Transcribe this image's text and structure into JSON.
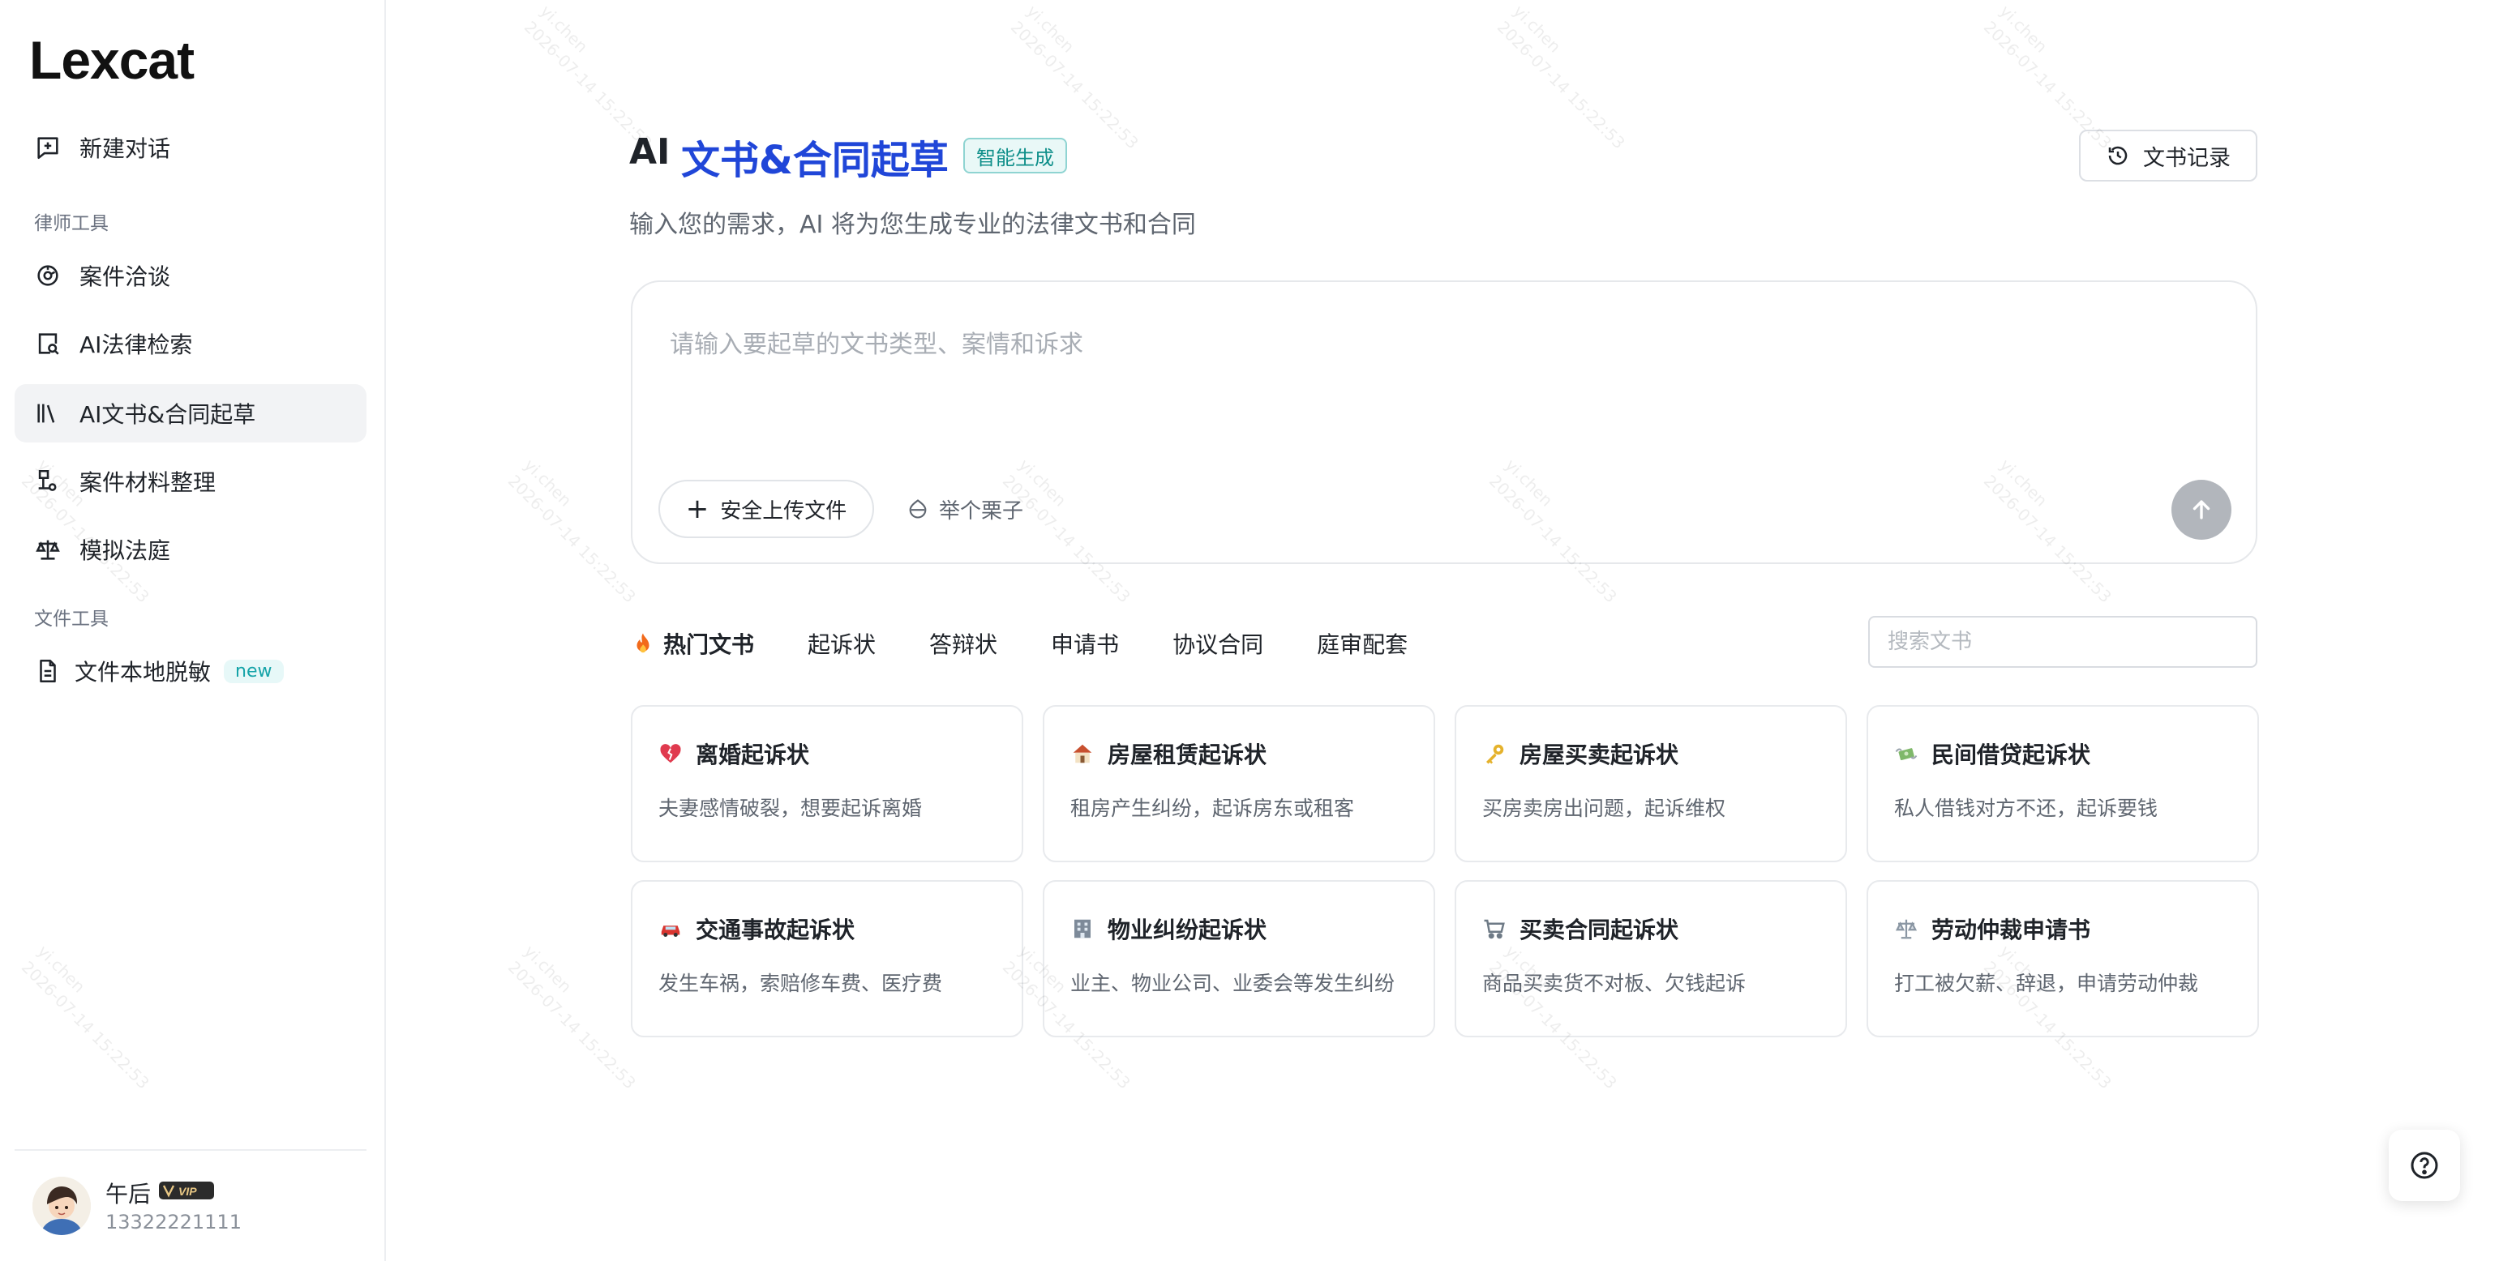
{
  "sidebar": {
    "logo": "Lexcat",
    "new_chat": {
      "label": "新建对话",
      "icon": "new-chat-icon"
    },
    "lawyer_tools_label": "律师工具",
    "lawyer_tools": [
      {
        "label": "案件洽谈",
        "icon": "case-talk-icon",
        "active": false
      },
      {
        "label": "AI法律检索",
        "icon": "law-search-icon",
        "active": false
      },
      {
        "label": "AI文书&合同起草",
        "icon": "library-icon",
        "active": true
      },
      {
        "label": "案件材料整理",
        "icon": "materials-icon",
        "active": false
      },
      {
        "label": "模拟法庭",
        "icon": "scale-icon",
        "active": false
      }
    ],
    "file_tools_label": "文件工具",
    "file_tools": [
      {
        "label": "文件本地脱敏",
        "icon": "document-icon",
        "badge": "new"
      }
    ],
    "user": {
      "name": "午后",
      "vip_label": "VIP",
      "phone": "13322221111"
    }
  },
  "main": {
    "title_prefix": "AI",
    "title": "文书&合同起草",
    "title_badge": "智能生成",
    "record_button": "文书记录",
    "subtitle": "输入您的需求，AI 将为您生成专业的法律文书和合同",
    "input": {
      "placeholder": "请输入要起草的文书类型、案情和诉求",
      "upload_label": "安全上传文件",
      "example_label": "举个栗子"
    },
    "tabs": [
      {
        "label": "热门文书",
        "active": true,
        "icon": "fire-icon"
      },
      {
        "label": "起诉状",
        "active": false
      },
      {
        "label": "答辩状",
        "active": false
      },
      {
        "label": "申请书",
        "active": false
      },
      {
        "label": "协议合同",
        "active": false
      },
      {
        "label": "庭审配套",
        "active": false
      }
    ],
    "search_placeholder": "搜索文书",
    "cards": [
      {
        "title": "离婚起诉状",
        "desc": "夫妻感情破裂，想要起诉离婚",
        "icon": "broken-heart-icon"
      },
      {
        "title": "房屋租赁起诉状",
        "desc": "租房产生纠纷，起诉房东或租客",
        "icon": "house-icon"
      },
      {
        "title": "房屋买卖起诉状",
        "desc": "买房卖房出问题，起诉维权",
        "icon": "key-icon"
      },
      {
        "title": "民间借贷起诉状",
        "desc": "私人借钱对方不还，起诉要钱",
        "icon": "money-wings-icon"
      },
      {
        "title": "交通事故起诉状",
        "desc": "发生车祸，索赔修车费、医疗费",
        "icon": "car-icon"
      },
      {
        "title": "物业纠纷起诉状",
        "desc": "业主、物业公司、业委会等发生纠纷",
        "icon": "office-building-icon"
      },
      {
        "title": "买卖合同起诉状",
        "desc": "商品买卖货不对板、欠钱起诉",
        "icon": "cart-icon"
      },
      {
        "title": "劳动仲裁申请书",
        "desc": "打工被欠薪、辞退，申请劳动仲裁",
        "icon": "balance-icon"
      }
    ]
  },
  "watermark": {
    "name": "yi.chen",
    "datetime": "2026-07-14 15:22:53"
  },
  "colors": {
    "accent": "#2046d8",
    "teal": "#14a3a8",
    "active_bg": "#f2f3f5"
  }
}
